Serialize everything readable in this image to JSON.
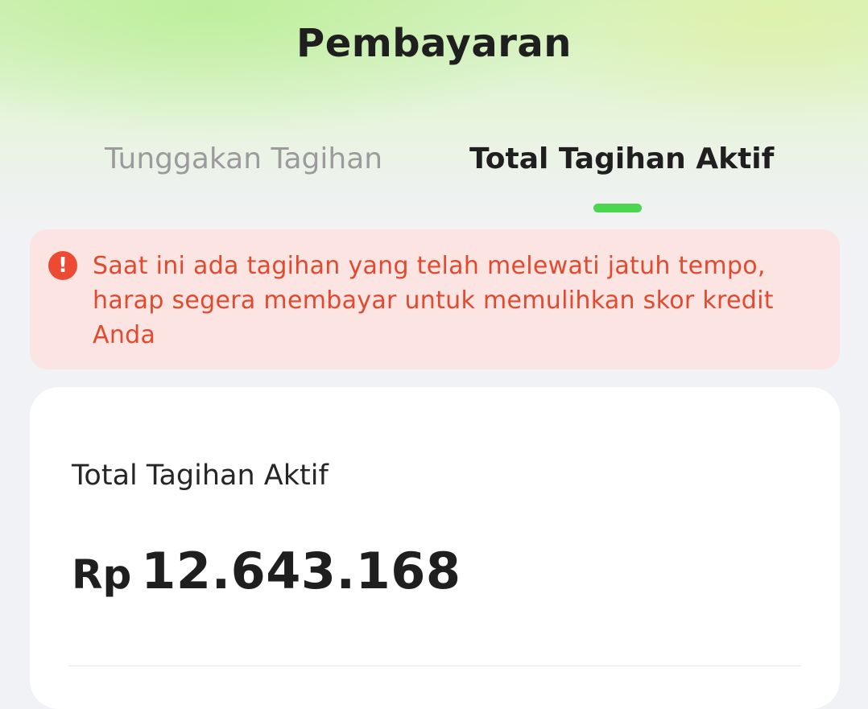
{
  "header": {
    "title": "Pembayaran"
  },
  "tabs": [
    {
      "label": "Tunggakan Tagihan",
      "active": false
    },
    {
      "label": "Total Tagihan Aktif",
      "active": true
    }
  ],
  "alert": {
    "icon": "exclamation-circle-icon",
    "icon_glyph": "!",
    "message": "Saat ini ada tagihan yang telah melewati jatuh tempo, harap segera membayar untuk memulihkan skor kredit Anda"
  },
  "summary": {
    "label": "Total Tagihan Aktif",
    "currency": "Rp",
    "amount": "12.643.168"
  },
  "colors": {
    "accent": "#4cd54f",
    "alert_text": "#e14a2e",
    "alert_bg": "#fbe4e1"
  }
}
